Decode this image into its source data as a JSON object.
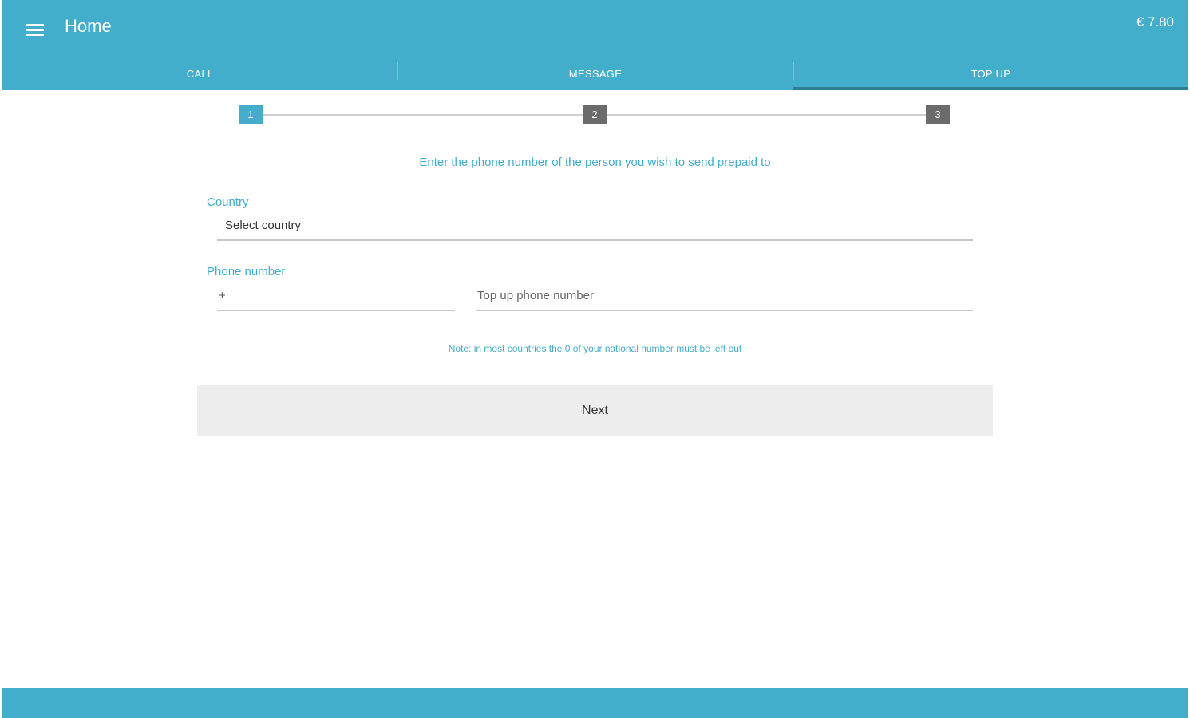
{
  "header": {
    "title": "Home",
    "balance": "€ 7.80",
    "menu_icon": "hamburger-menu-icon"
  },
  "tabs": [
    {
      "label": "CALL",
      "active": false
    },
    {
      "label": "MESSAGE",
      "active": false
    },
    {
      "label": "TOP UP",
      "active": true
    }
  ],
  "stepper": {
    "steps": [
      "1",
      "2",
      "3"
    ],
    "current": 1
  },
  "form": {
    "instruction": "Enter the phone number of the person you wish to send prepaid to",
    "country_label": "Country",
    "country_value": "Select country",
    "phone_label": "Phone number",
    "prefix_value": "+",
    "phone_placeholder": "Top up phone number",
    "note": "Note: in most countries the 0 of your national number must be left out",
    "next_label": "Next"
  },
  "colors": {
    "primary": "#42aecb",
    "active_tab_indicator": "#2d7f94",
    "inactive_step": "#6b6b6b",
    "button_bg": "#ededee"
  }
}
